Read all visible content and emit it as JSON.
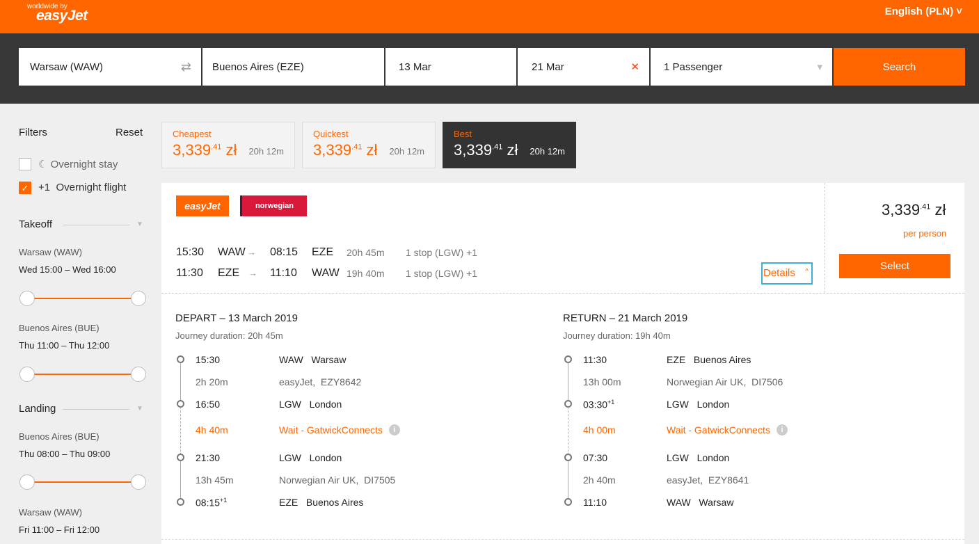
{
  "header": {
    "tagline": "worldwide by",
    "logo": "easyJet",
    "language": "English (PLN) ˅"
  },
  "search": {
    "origin": "Warsaw (WAW)",
    "destination": "Buenos Aires (EZE)",
    "depart_date": "13 Mar",
    "return_date": "21 Mar",
    "passengers": "1 Passenger",
    "search_label": "Search",
    "swap_icon": "⇄",
    "clear_icon": "✕",
    "dropdown_icon": "▾"
  },
  "filters": {
    "title": "Filters",
    "reset": "Reset",
    "overnight_stay": "Overnight stay",
    "overnight_flight_prefix": "+1",
    "overnight_flight": "Overnight flight",
    "takeoff": {
      "title": "Takeoff",
      "a_label": "Warsaw (WAW)",
      "a_value": "Wed 15:00 – Wed 16:00",
      "b_label": "Buenos Aires (BUE)",
      "b_value": "Thu 11:00 – Thu 12:00"
    },
    "landing": {
      "title": "Landing",
      "a_label": "Buenos Aires (BUE)",
      "a_value": "Thu 08:00 – Thu 09:00",
      "b_label": "Warsaw (WAW)",
      "b_value": "Fri 11:00 – Fri 12:00"
    }
  },
  "sort": {
    "cheapest": {
      "label": "Cheapest",
      "price_int": "3,339",
      "price_dec": ".41",
      "currency": "zł",
      "duration": "20h 12m"
    },
    "quickest": {
      "label": "Quickest",
      "price_int": "3,339",
      "price_dec": ".41",
      "currency": "zł",
      "duration": "20h 12m"
    },
    "best": {
      "label": "Best",
      "price_int": "3,339",
      "price_dec": ".41",
      "currency": "zł",
      "duration": "20h 12m"
    }
  },
  "result": {
    "airline1": "easyJet",
    "airline2": "norwegian",
    "outbound": {
      "dep": "15:30",
      "from": "WAW",
      "arr": "08:15",
      "to": "EZE",
      "dur": "20h 45m",
      "stops": "1 stop (LGW) +1"
    },
    "inbound": {
      "dep": "11:30",
      "from": "EZE",
      "arr": "11:10",
      "to": "WAW",
      "dur": "19h 40m",
      "stops": "1 stop (LGW) +1"
    },
    "details": "Details",
    "price_int": "3,339",
    "price_dec": ".41",
    "currency": "zł",
    "per_person": "per person",
    "select": "Select"
  },
  "depart": {
    "title": "DEPART – 13 March 2019",
    "duration": "Journey duration: 20h 45m",
    "s1_time": "15:30",
    "s1_code": "WAW",
    "s1_city": "Warsaw",
    "f1_dur": "2h 20m",
    "f1_airline": "easyJet,",
    "f1_flight": "EZY8642",
    "s2_time": "16:50",
    "s2_code": "LGW",
    "s2_city": "London",
    "wait_dur": "4h 40m",
    "wait_label": "Wait - GatwickConnects",
    "s3_time": "21:30",
    "s3_code": "LGW",
    "s3_city": "London",
    "f2_dur": "13h 45m",
    "f2_airline": "Norwegian Air UK,",
    "f2_flight": "DI7505",
    "s4_time": "08:15",
    "s4_plus": "+1",
    "s4_code": "EZE",
    "s4_city": "Buenos Aires"
  },
  "return": {
    "title": "RETURN – 21 March 2019",
    "duration": "Journey duration: 19h 40m",
    "s1_time": "11:30",
    "s1_code": "EZE",
    "s1_city": "Buenos Aires",
    "f1_dur": "13h 00m",
    "f1_airline": "Norwegian Air UK,",
    "f1_flight": "DI7506",
    "s2_time": "03:30",
    "s2_plus": "+1",
    "s2_code": "LGW",
    "s2_city": "London",
    "wait_dur": "4h 00m",
    "wait_label": "Wait - GatwickConnects",
    "s3_time": "07:30",
    "s3_code": "LGW",
    "s3_city": "London",
    "f2_dur": "2h 40m",
    "f2_airline": "easyJet,",
    "f2_flight": "EZY8641",
    "s4_time": "11:10",
    "s4_code": "WAW",
    "s4_city": "Warsaw"
  }
}
